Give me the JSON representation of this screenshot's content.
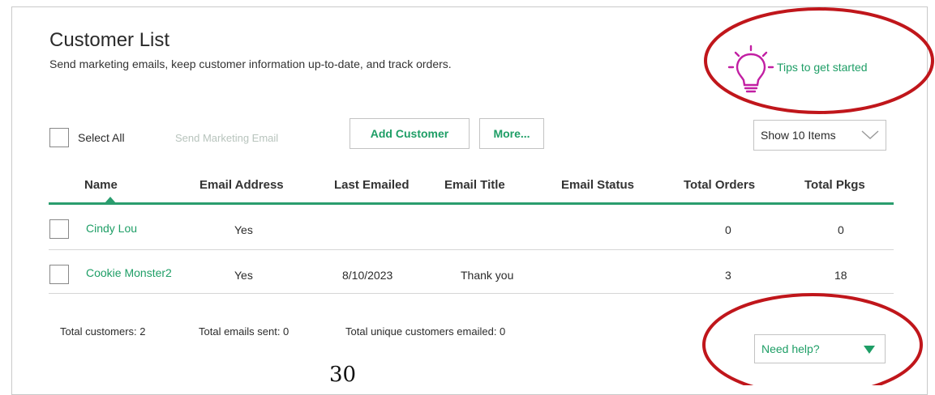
{
  "header": {
    "title": "Customer List",
    "subtitle": "Send marketing emails, keep customer information up-to-date, and track orders."
  },
  "tips": {
    "label": "Tips to get started",
    "icon": "lightbulb-icon"
  },
  "toolbar": {
    "select_all": "Select All",
    "send_marketing_email": "Send Marketing Email",
    "add_customer": "Add Customer",
    "more": "More...",
    "show_items": "Show 10 Items"
  },
  "table": {
    "columns": [
      "Name",
      "Email Address",
      "Last Emailed",
      "Email Title",
      "Email Status",
      "Total Orders",
      "Total Pkgs"
    ],
    "rows": [
      {
        "name": "Cindy Lou",
        "email_address": "Yes",
        "last_emailed": "",
        "email_title": "",
        "email_status": "",
        "total_orders": "0",
        "total_pkgs": "0"
      },
      {
        "name": "Cookie Monster2",
        "email_address": "Yes",
        "last_emailed": "8/10/2023",
        "email_title": "Thank you",
        "email_status": "",
        "total_orders": "3",
        "total_pkgs": "18"
      }
    ]
  },
  "footer": {
    "total_customers": "Total customers: 2",
    "total_emails_sent": "Total emails sent: 0",
    "total_unique": "Total unique customers emailed: 0"
  },
  "help": {
    "label": "Need help?"
  },
  "page_number": "30",
  "colors": {
    "accent": "#1e9e66",
    "annotation": "#c0161b",
    "bulb": "#c21fa3"
  }
}
